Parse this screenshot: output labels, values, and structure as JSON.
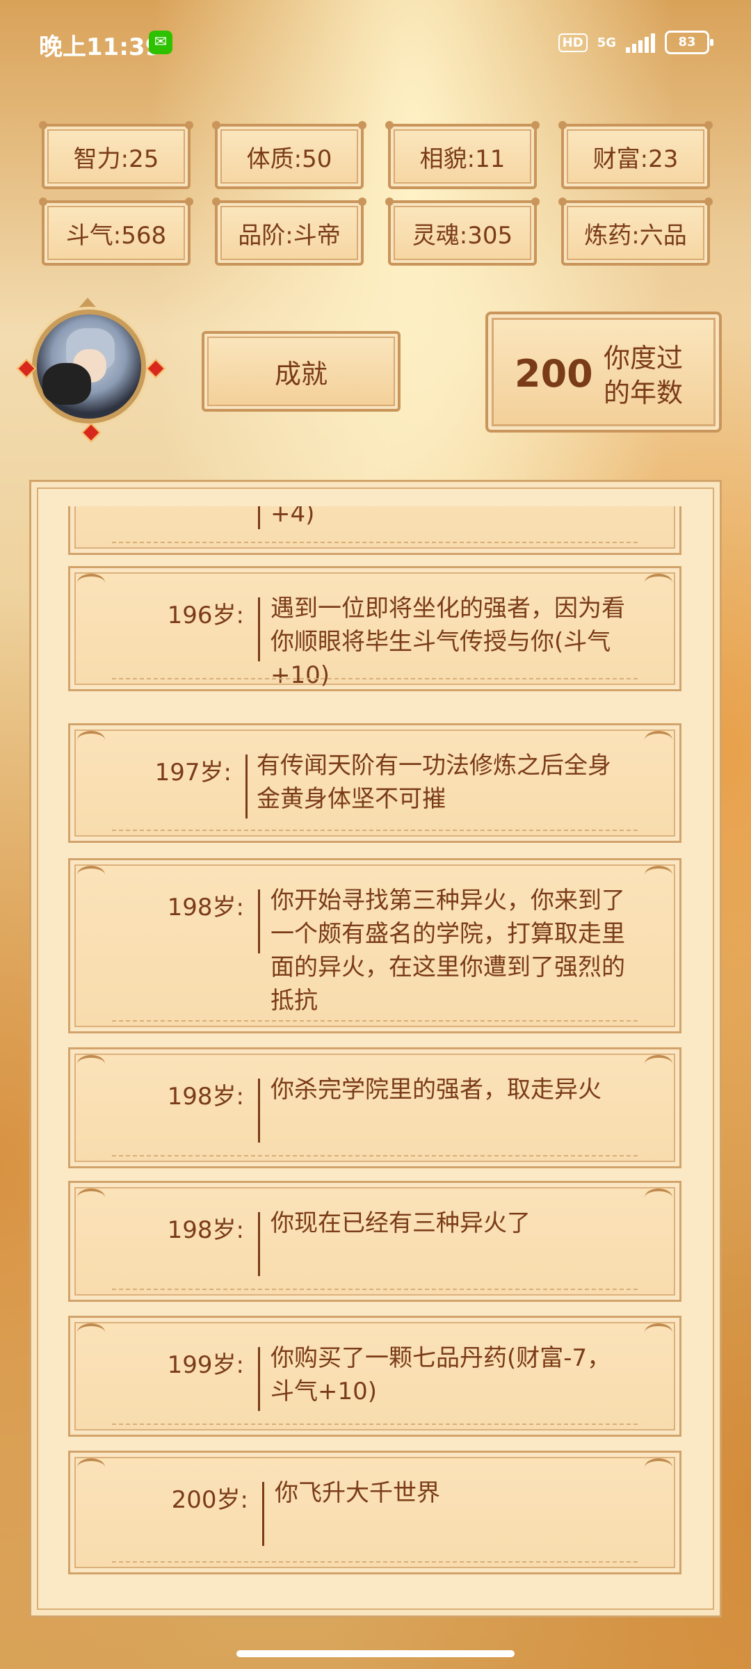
{
  "status_bar": {
    "time": "晚上11:39",
    "hd": "HD",
    "network": "5G",
    "battery": "83"
  },
  "stats": [
    {
      "label": "智力:25"
    },
    {
      "label": "体质:50"
    },
    {
      "label": "相貌:11"
    },
    {
      "label": "财富:23"
    },
    {
      "label": "斗气:568"
    },
    {
      "label": "品阶:斗帝"
    },
    {
      "label": "灵魂:305"
    },
    {
      "label": "炼药:六品"
    }
  ],
  "achievement": {
    "label": "成就"
  },
  "years": {
    "value": "200",
    "label": "你度过的年数"
  },
  "log": {
    "partial_top": "+4)",
    "entries": [
      {
        "age": "196岁:",
        "text": "遇到一位即将坐化的强者，因为看你顺眼将毕生斗气传授与你(斗气+10)"
      },
      {
        "age": "197岁:",
        "text": "有传闻天阶有一功法修炼之后全身金黄身体坚不可摧"
      },
      {
        "age": "198岁:",
        "text": "你开始寻找第三种异火，你来到了一个颇有盛名的学院，打算取走里面的异火，在这里你遭到了强烈的抵抗"
      },
      {
        "age": "198岁:",
        "text": "你杀完学院里的强者，取走异火"
      },
      {
        "age": "198岁:",
        "text": "你现在已经有三种异火了"
      },
      {
        "age": "199岁:",
        "text": "你购买了一颗七品丹药(财富-7，斗气+10)"
      },
      {
        "age": "200岁:",
        "text": "你飞升大千世界"
      }
    ]
  }
}
